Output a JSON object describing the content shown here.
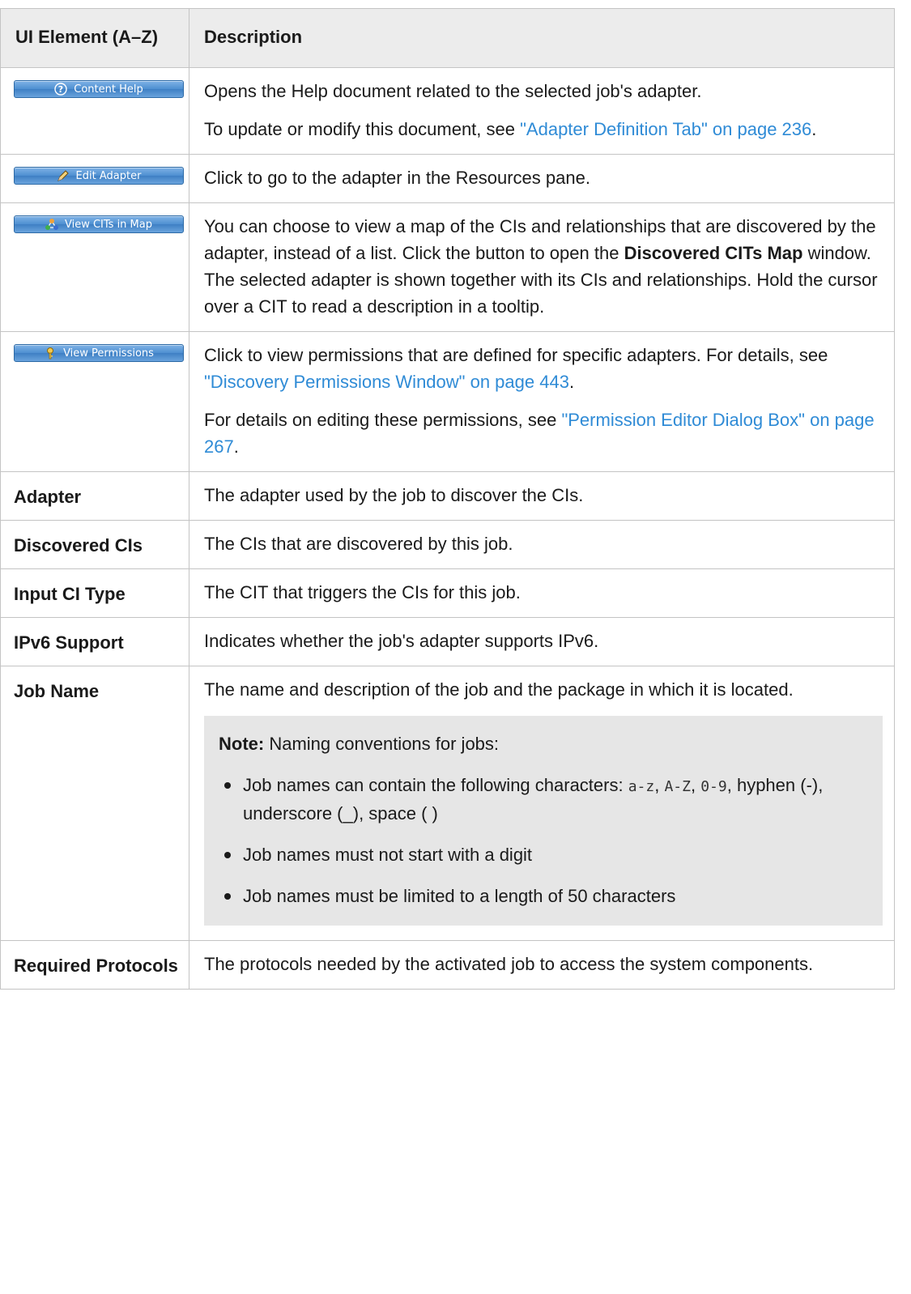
{
  "header": {
    "col1": "UI Element (A–Z)",
    "col2": "Description"
  },
  "rows": {
    "content_help": {
      "button_label": "Content Help",
      "icon": "help-icon",
      "p1": "Opens the Help document related to the selected job's adapter.",
      "p2_pre": "To update or modify this document, see ",
      "p2_link": "\"Adapter Definition Tab\" on page 236",
      "p2_post": "."
    },
    "edit_adapter": {
      "button_label": "Edit Adapter",
      "icon": "pencil-icon",
      "p1": "Click to go to the adapter in the Resources pane."
    },
    "view_cits": {
      "button_label": "View CITs in Map",
      "icon": "map-icon",
      "p1_pre": "You can choose to view a map of the CIs and relationships that are discovered by the adapter, instead of a list. Click the button to open the ",
      "p1_bold": "Discovered CITs Map",
      "p1_post": " window. The selected adapter is shown together with its CIs and relationships. Hold the cursor over a CIT to read a description in a tooltip."
    },
    "view_permissions": {
      "button_label": "View Permissions",
      "icon": "key-icon",
      "p1_pre": "Click to view permissions that are defined for specific adapters. For details, see ",
      "p1_link": "\"Discovery Permissions Window\" on page 443",
      "p1_post": ".",
      "p2_pre": "For details on editing these permissions, see ",
      "p2_link": "\"Permission Editor Dialog Box\" on page 267",
      "p2_post": "."
    },
    "adapter": {
      "name": "Adapter",
      "desc": "The adapter used by the job to discover the CIs."
    },
    "discovered_cis": {
      "name": "Discovered CIs",
      "desc": "The CIs that are discovered by this job."
    },
    "input_ci_type": {
      "name": "Input CI Type",
      "desc": "The CIT that triggers the CIs for this job."
    },
    "ipv6_support": {
      "name": "IPv6 Support",
      "desc": "Indicates whether the job's adapter supports IPv6."
    },
    "job_name": {
      "name": "Job Name",
      "desc": "The name and description of the job and the package in which it is located.",
      "note_label": "Note:",
      "note_text": " Naming conventions for jobs:",
      "bullet1_pre": "Job names can contain the following characters: ",
      "bullet1_code1": "a-z",
      "bullet1_sep1": ", ",
      "bullet1_code2": "A-Z",
      "bullet1_sep2": ", ",
      "bullet1_code3": "0-9",
      "bullet1_post": ", hyphen (-), underscore (_), space ( )",
      "bullet2": "Job names must not start with a digit",
      "bullet3": "Job names must be limited to a length of 50 characters"
    },
    "required_protocols": {
      "name": "Required Protocols",
      "desc": "The protocols needed by the activated job to access the system components."
    }
  }
}
